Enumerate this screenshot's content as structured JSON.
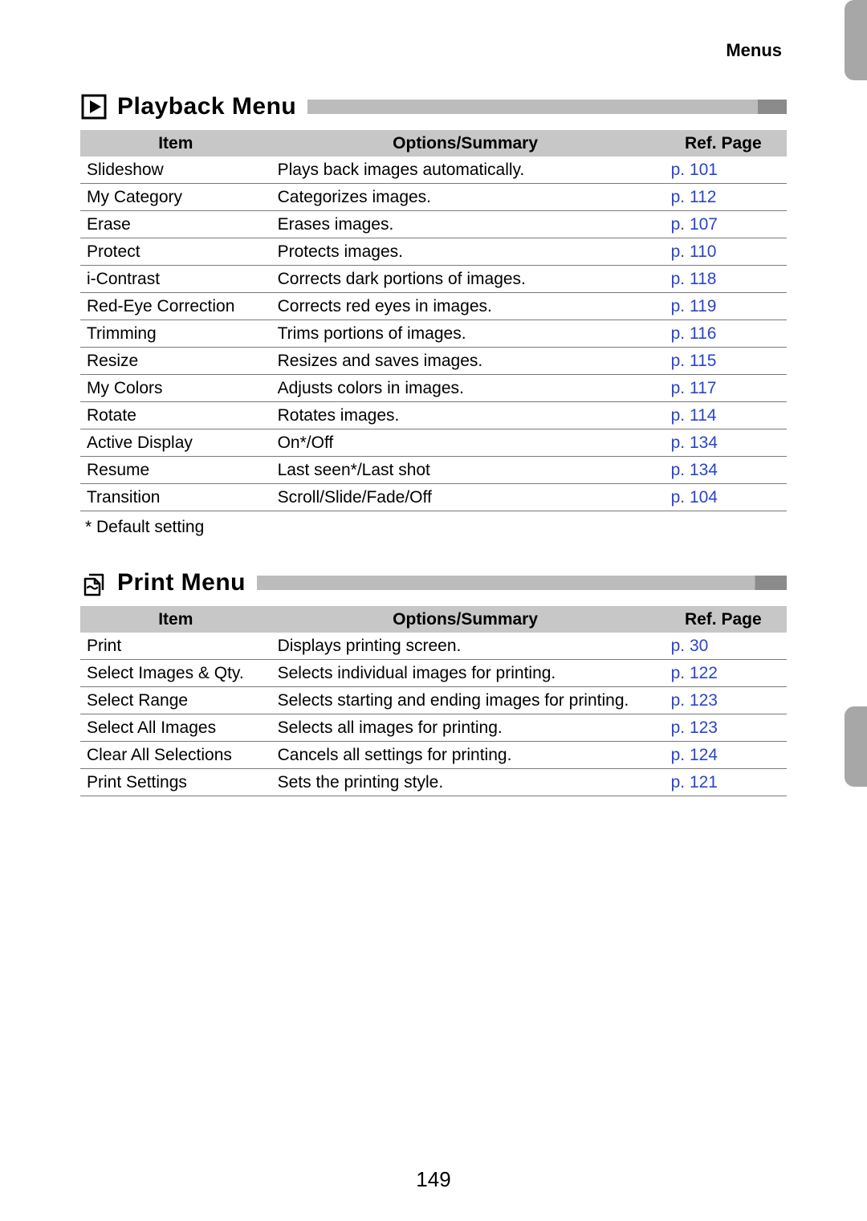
{
  "running_head": "Menus",
  "page_number": "149",
  "footnote": "* Default setting",
  "table_headers": {
    "item": "Item",
    "summary": "Options/Summary",
    "ref": "Ref. Page"
  },
  "sections": [
    {
      "icon": "play-box-icon",
      "title": "Playback Menu",
      "rows": [
        {
          "item": "Slideshow",
          "summary": "Plays back images automatically.",
          "ref": "p. 101"
        },
        {
          "item": "My Category",
          "summary": "Categorizes images.",
          "ref": "p. 112"
        },
        {
          "item": "Erase",
          "summary": "Erases images.",
          "ref": "p. 107"
        },
        {
          "item": "Protect",
          "summary": "Protects images.",
          "ref": "p. 110"
        },
        {
          "item": "i-Contrast",
          "summary": "Corrects dark portions of images.",
          "ref": "p. 118"
        },
        {
          "item": "Red-Eye Correction",
          "summary": "Corrects red eyes in images.",
          "ref": "p. 119"
        },
        {
          "item": "Trimming",
          "summary": "Trims portions of images.",
          "ref": "p. 116"
        },
        {
          "item": "Resize",
          "summary": "Resizes and saves images.",
          "ref": "p. 115"
        },
        {
          "item": "My Colors",
          "summary": "Adjusts colors in images.",
          "ref": "p. 117"
        },
        {
          "item": "Rotate",
          "summary": "Rotates images.",
          "ref": "p. 114"
        },
        {
          "item": "Active Display",
          "summary": "On*/Off",
          "ref": "p. 134"
        },
        {
          "item": "Resume",
          "summary": "Last seen*/Last shot",
          "ref": "p. 134"
        },
        {
          "item": "Transition",
          "summary": "Scroll/Slide/Fade/Off",
          "ref": "p. 104"
        }
      ],
      "show_footnote": true
    },
    {
      "icon": "print-icon",
      "title": "Print Menu",
      "rows": [
        {
          "item": "Print",
          "summary": "Displays printing screen.",
          "ref": "p. 30"
        },
        {
          "item": "Select Images & Qty.",
          "summary": "Selects individual images for printing.",
          "ref": "p. 122"
        },
        {
          "item": "Select Range",
          "summary": "Selects starting and ending images for printing.",
          "ref": "p. 123"
        },
        {
          "item": "Select All Images",
          "summary": "Selects all images for printing.",
          "ref": "p. 123"
        },
        {
          "item": "Clear All Selections",
          "summary": "Cancels all settings for printing.",
          "ref": "p. 124"
        },
        {
          "item": "Print Settings",
          "summary": "Sets the printing style.",
          "ref": "p. 121"
        }
      ],
      "show_footnote": false
    }
  ]
}
